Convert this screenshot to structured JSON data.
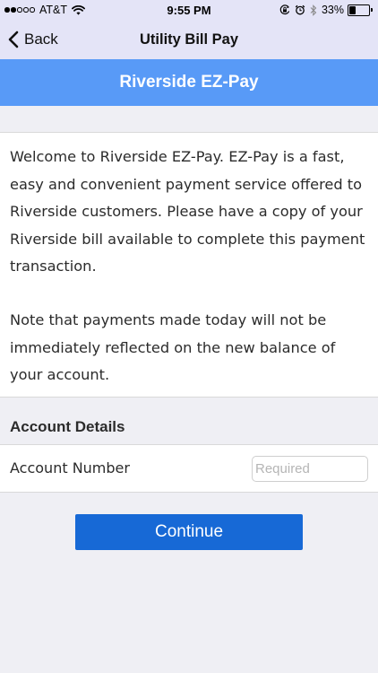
{
  "status_bar": {
    "carrier": "AT&T",
    "time": "9:55 PM",
    "battery_percent": "33%",
    "battery_level": 0.33,
    "signal_bars_filled": 2,
    "signal_bars_total": 5,
    "icons": [
      "wifi-icon",
      "orientation-lock-icon",
      "alarm-icon",
      "bluetooth-icon",
      "battery-icon"
    ]
  },
  "nav": {
    "back_label": "Back",
    "title": "Utility Bill Pay"
  },
  "banner": {
    "title": "Riverside EZ-Pay"
  },
  "intro": {
    "paragraph1": "Welcome to Riverside EZ-Pay. EZ-Pay is a fast, easy and convenient payment service offered to Riverside customers. Please have a copy of your Riverside bill available to complete this payment transaction.",
    "paragraph2": "Note that payments made today will not be immediately reflected on the new balance of your account."
  },
  "account_details": {
    "header": "Account Details",
    "account_number_label": "Account Number",
    "account_number_value": "",
    "account_number_placeholder": "Required"
  },
  "actions": {
    "continue_label": "Continue"
  },
  "colors": {
    "header_bg": "#e4e4f7",
    "banner_bg": "#589af7",
    "button_bg": "#1769d6",
    "page_bg": "#efeff4"
  }
}
